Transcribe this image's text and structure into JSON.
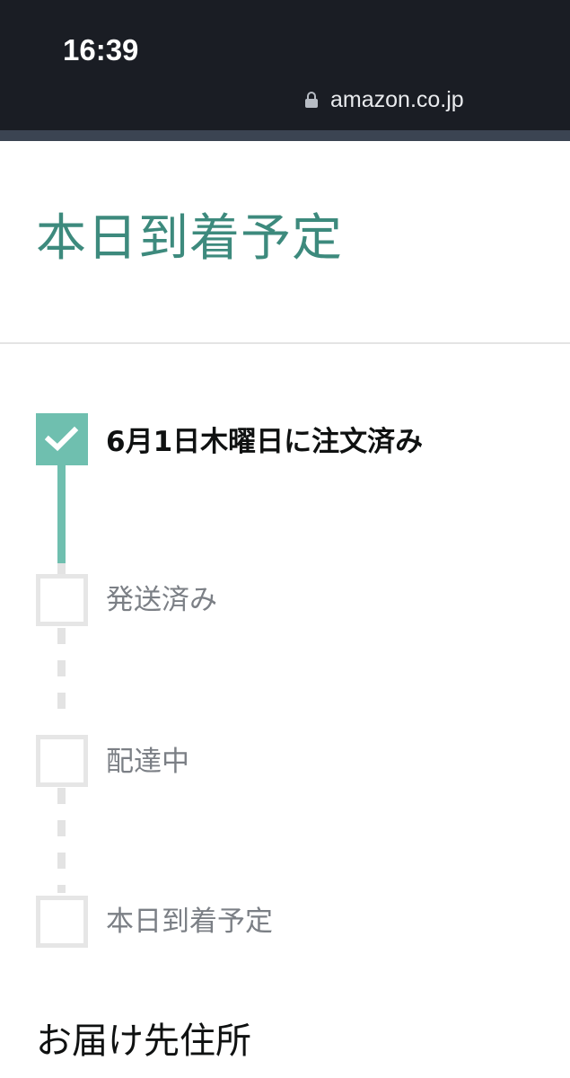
{
  "status_bar": {
    "time": "16:39",
    "url": "amazon.co.jp",
    "url_icon": "lock-icon"
  },
  "main": {
    "title": "本日到着予定",
    "steps": [
      {
        "label": "6月1日木曜日に注文済み",
        "completed": true,
        "icon": "check-icon"
      },
      {
        "label": "発送済み",
        "completed": false
      },
      {
        "label": "配達中",
        "completed": false
      },
      {
        "label": "本日到着予定",
        "completed": false
      }
    ],
    "address_heading": "お届け先住所"
  },
  "colors": {
    "accent": "#3d8a7d",
    "progress_complete": "#6fbfaf",
    "progress_pending": "#e6e6e6",
    "status_bar_bg": "#1a1d24",
    "accent_strip": "#3b4452"
  }
}
